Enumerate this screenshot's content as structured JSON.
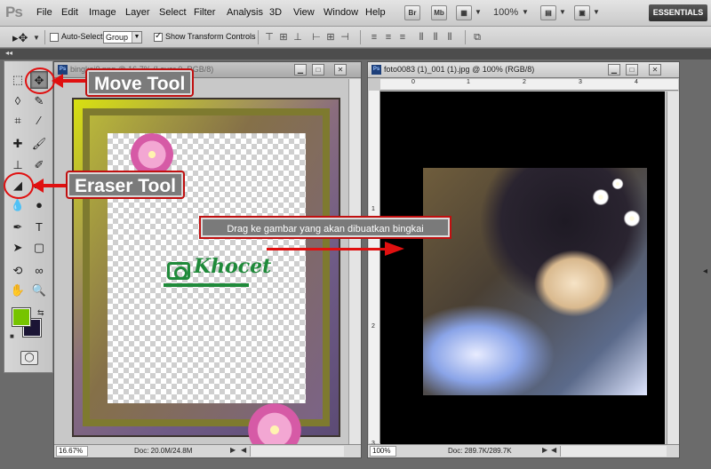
{
  "app": {
    "logo": "Ps",
    "menu": [
      "File",
      "Edit",
      "Image",
      "Layer",
      "Select",
      "Filter",
      "Analysis",
      "3D",
      "View",
      "Window",
      "Help"
    ],
    "bridge_btn": "Br",
    "minibridge_btn": "Mb",
    "zoom": "100%",
    "workspace": "ESSENTIALS"
  },
  "options": {
    "auto_select_label": "Auto-Select:",
    "auto_select_checked": false,
    "auto_select_value": "Group",
    "show_transform_label": "Show Transform Controls",
    "show_transform_checked": true
  },
  "annotations": {
    "move_tool": "Move Tool",
    "eraser_tool": "Eraser Tool",
    "drag_hint": "Drag ke gambar yang akan dibuatkan bingkai"
  },
  "documents": [
    {
      "name": "bingkai0.png @ 16.7% (Layer 0, RGB/8)",
      "zoom": "16.67%",
      "doc_size": "Doc: 20.0M/24.8M",
      "logo_text": "Khocet"
    },
    {
      "name": "foto0083 (1)_001 (1).jpg @ 100% (RGB/8)",
      "zoom": "100%",
      "doc_size": "Doc: 289.7K/289.7K",
      "ruler_h": [
        "0",
        "1",
        "2",
        "3",
        "4"
      ],
      "ruler_v": [
        "1",
        "2",
        "3"
      ]
    }
  ],
  "colors": {
    "foreground": "#76c400",
    "background": "#1b1535",
    "annotation_red": "#e01010"
  }
}
